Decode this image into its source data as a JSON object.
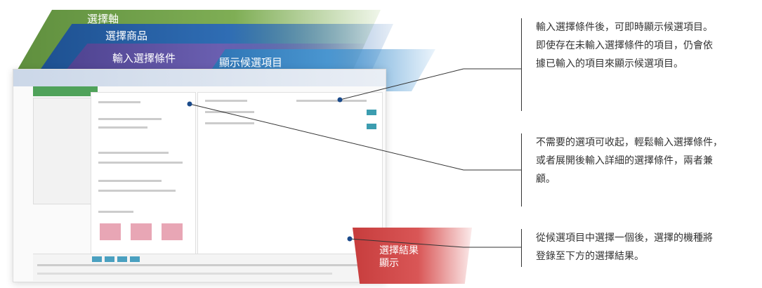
{
  "banners": {
    "axis": "選擇軸",
    "product": "選擇商品",
    "input": "輸入選擇條件",
    "candidates": "顯示候選項目",
    "result_line1": "選擇結果",
    "result_line2": "顯示"
  },
  "callouts": [
    {
      "line1": "輸入選擇條件後，可即時顯示候選項目。",
      "line2": "即使存在未輸入選擇條件的項目，仍會依",
      "line3": "據已輸入的項目來顯示候選項目。"
    },
    {
      "line1": "不需要的選項可收起，輕鬆輸入選擇條件，",
      "line2": "或者展開後輸入詳細的選擇條件，兩者兼",
      "line3": "顧。"
    },
    {
      "line1": "從候選項目中選擇一個後，選擇的機種將",
      "line2": "登錄至下方的選擇結果。"
    }
  ],
  "colors": {
    "green": "#5f8f3e",
    "blue": "#1d4f8f",
    "purple": "#4b3f8c",
    "light_blue": "#2a6fb0",
    "red": "#c73d3d"
  }
}
